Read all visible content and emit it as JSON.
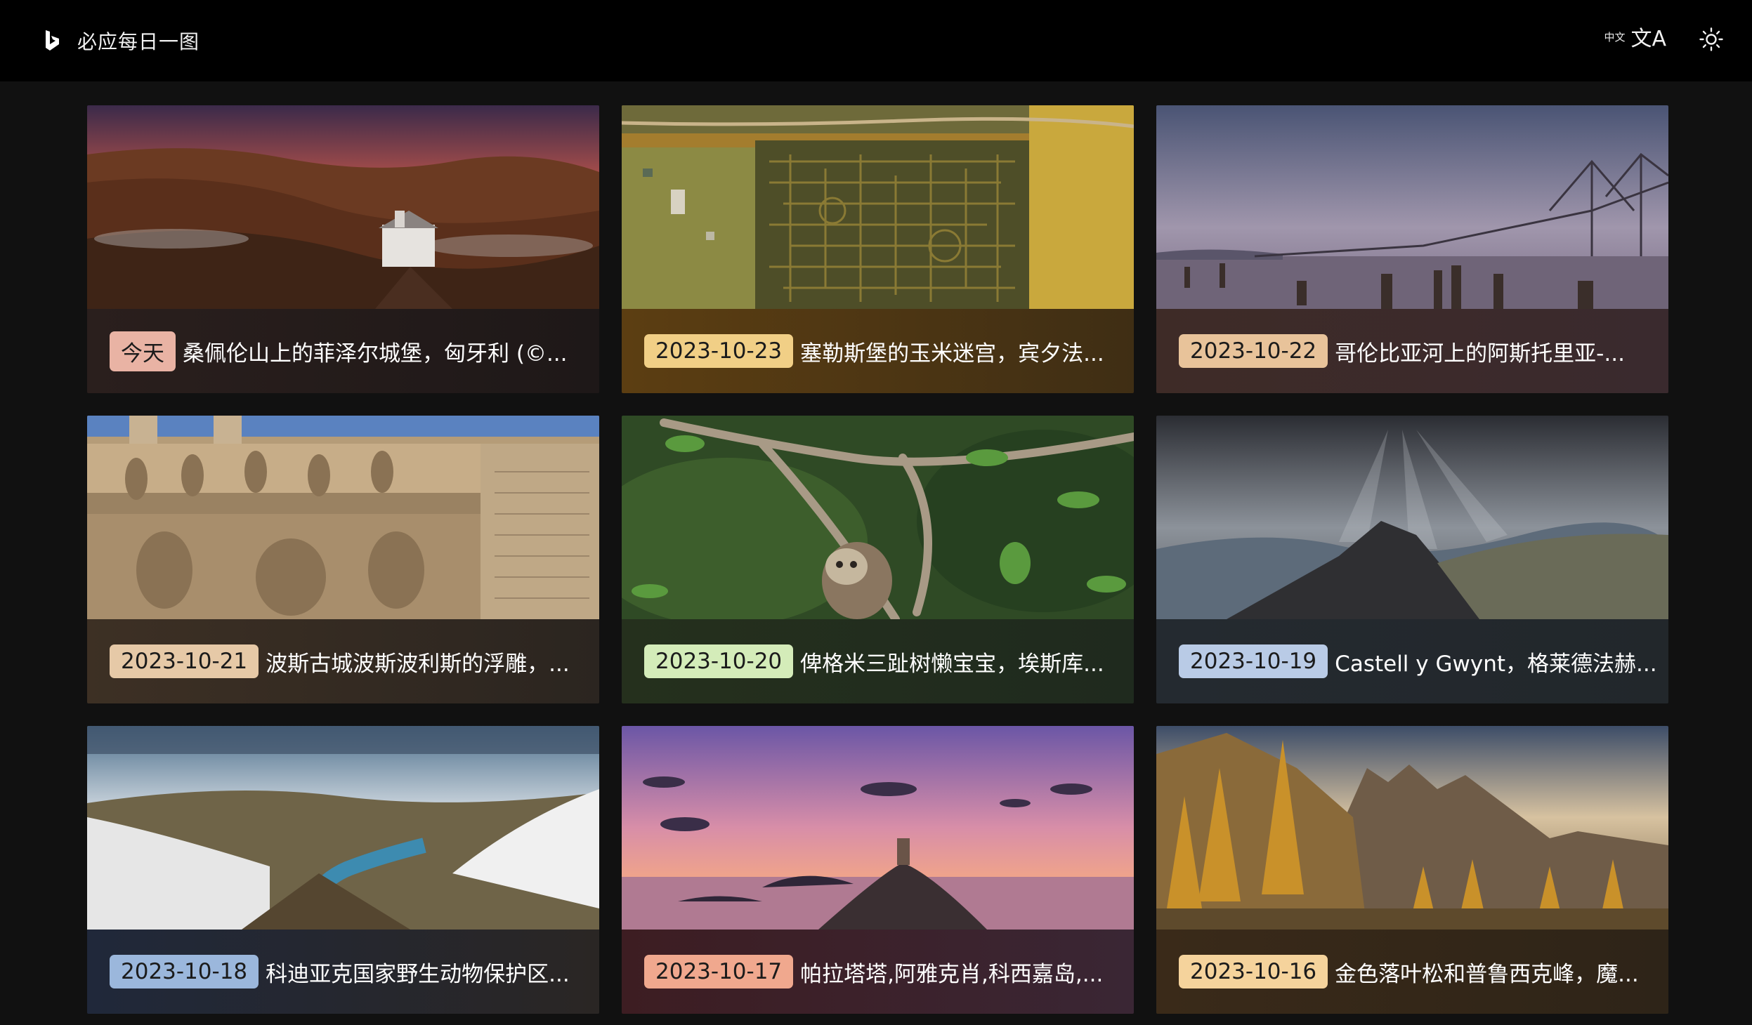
{
  "header": {
    "title": "必应每日一图",
    "lang_small": "中文",
    "lang_big": "文A",
    "logo_icon": "bing-logo-icon",
    "translate_icon": "translate-icon",
    "theme_icon": "sun-icon"
  },
  "cards": [
    {
      "badge": "今天",
      "title": "桑佩伦山上的菲泽尔城堡，匈牙利 (©...",
      "badge_color": "#e9b3a4",
      "foot_color": "#2a1f1d"
    },
    {
      "badge": "2023-10-23",
      "title": "塞勒斯堡的玉米迷宫，宾夕法...",
      "badge_color": "#f1cf86",
      "foot_color": "#5c3e12"
    },
    {
      "badge": "2023-10-22",
      "title": "哥伦比亚河上的阿斯托里亚-...",
      "badge_color": "#e8c39a",
      "foot_color": "#3e2b27"
    },
    {
      "badge": "2023-10-21",
      "title": "波斯古城波斯波利斯的浮雕，...",
      "badge_color": "#e6c9a7",
      "foot_color": "#3d3024"
    },
    {
      "badge": "2023-10-20",
      "title": "俾格米三趾树懒宝宝，埃斯库...",
      "badge_color": "#d4ecb9",
      "foot_color": "#25301d"
    },
    {
      "badge": "2023-10-19",
      "title": "Castell y Gwynt，格莱德法赫...",
      "badge_color": "#b9cbe6",
      "foot_color": "#242a30"
    },
    {
      "badge": "2023-10-18",
      "title": "科迪亚克国家野生动物保护区...",
      "badge_color": "#9bb7dc",
      "foot_color": "#20283a"
    },
    {
      "badge": "2023-10-17",
      "title": "帕拉塔塔,阿雅克肖,科西嘉岛,...",
      "badge_color": "#f0a88e",
      "foot_color": "#3d1d22"
    },
    {
      "badge": "2023-10-16",
      "title": "金色落叶松和普鲁西克峰，魔...",
      "badge_color": "#f5d39c",
      "foot_color": "#3a2a19"
    }
  ]
}
